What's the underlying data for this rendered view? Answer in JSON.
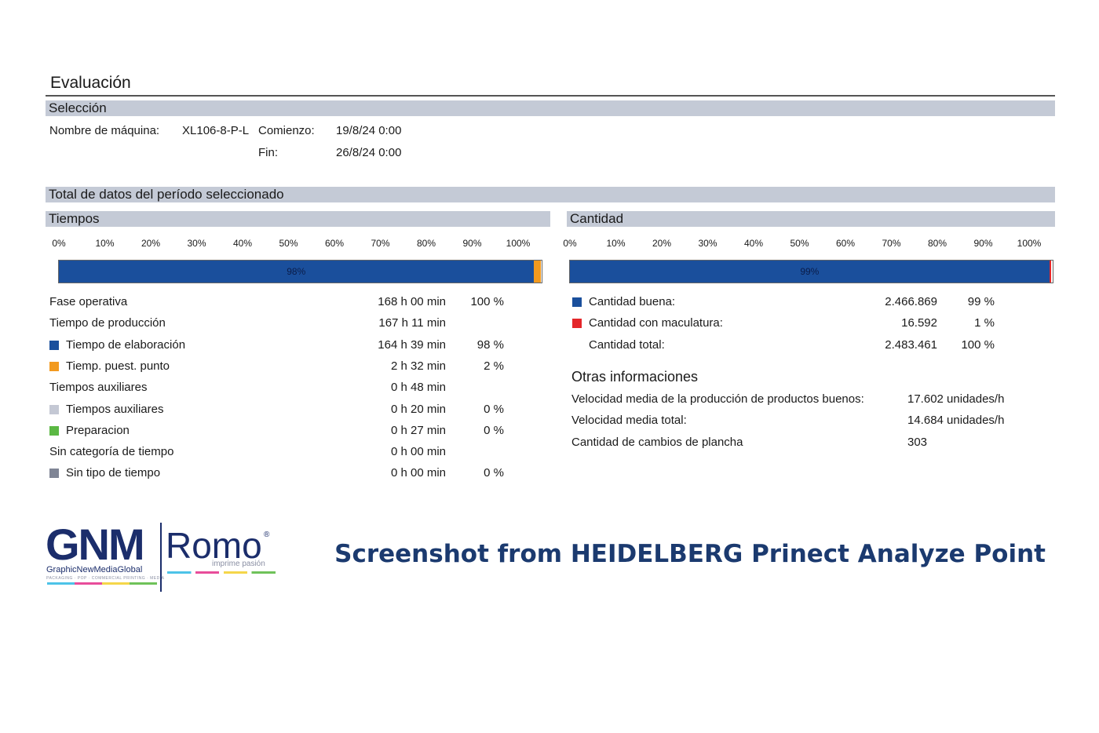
{
  "title": "Evaluación",
  "seleccion": {
    "header": "Selección",
    "machine_label": "Nombre de máquina:",
    "machine_value": "XL106-8-P-L",
    "start_label": "Comienzo:",
    "start_value": "19/8/24 0:00",
    "end_label": "Fin:",
    "end_value": "26/8/24 0:00"
  },
  "total_header": "Total de datos del período seleccionado",
  "axis_ticks": [
    "0%",
    "10%",
    "20%",
    "30%",
    "40%",
    "50%",
    "60%",
    "70%",
    "80%",
    "90%",
    "100%"
  ],
  "tiempos": {
    "header": "Tiempos",
    "bar": {
      "label": "98%",
      "segments": [
        {
          "fraction": 0.983,
          "color": "#1a4f9c"
        },
        {
          "fraction": 0.015,
          "color": "#f29a1f"
        }
      ]
    },
    "rows": [
      {
        "label": "Fase operativa",
        "value": "168 h 00 min",
        "pct": "100 %",
        "color": null
      },
      {
        "label": "Tiempo de producción",
        "value": "167 h 11 min",
        "pct": "",
        "color": null
      },
      {
        "label": "Tiempo de elaboración",
        "value": "164 h 39 min",
        "pct": "98 %",
        "color": "#1a4f9c"
      },
      {
        "label": "Tiemp. puest. punto",
        "value": "2 h 32 min",
        "pct": "2 %",
        "color": "#f29a1f"
      },
      {
        "label": "Tiempos auxiliares",
        "value": "0 h 48 min",
        "pct": "",
        "color": null
      },
      {
        "label": "Tiempos auxiliares",
        "value": "0 h 20 min",
        "pct": "0 %",
        "color": "#c4c8d4"
      },
      {
        "label": "Preparacion",
        "value": "0 h 27 min",
        "pct": "0 %",
        "color": "#5bb844"
      },
      {
        "label": "Sin categoría de tiempo",
        "value": "0 h 00 min",
        "pct": "",
        "color": null
      },
      {
        "label": "Sin tipo de tiempo",
        "value": "0 h 00 min",
        "pct": "0 %",
        "color": "#7f8595"
      }
    ]
  },
  "cantidad": {
    "header": "Cantidad",
    "bar": {
      "label": "99%",
      "segments": [
        {
          "fraction": 0.993,
          "color": "#1a4f9c"
        },
        {
          "fraction": 0.004,
          "color": "#e4262a"
        }
      ]
    },
    "rows": [
      {
        "label": "Cantidad buena:",
        "value": "2.466.869",
        "pct": "99 %",
        "color": "#1a4f9c"
      },
      {
        "label": "Cantidad con maculatura:",
        "value": "16.592",
        "pct": "1 %",
        "color": "#e4262a"
      },
      {
        "label": "Cantidad total:",
        "value": "2.483.461",
        "pct": "100 %",
        "color": null
      }
    ]
  },
  "otras": {
    "header": "Otras informaciones",
    "rows": [
      {
        "label": "Velocidad media de la producción de productos buenos:",
        "value": "17.602 unidades/h"
      },
      {
        "label": "Velocidad media total:",
        "value": "14.684 unidades/h"
      },
      {
        "label": "Cantidad de cambios de plancha",
        "value": "303"
      }
    ]
  },
  "logo": {
    "gnm": "GNM",
    "romo": "Romo",
    "registered": "®",
    "gnm_sub": "GraphicNewMediaGlobal",
    "gnm_sub2": "PACKAGING · POP · COMMERCIAL PRINTING · MEDIA",
    "romo_tagline": "imprime pasión"
  },
  "caption": "Screenshot from HEIDELBERG Prinect Analyze Point"
}
